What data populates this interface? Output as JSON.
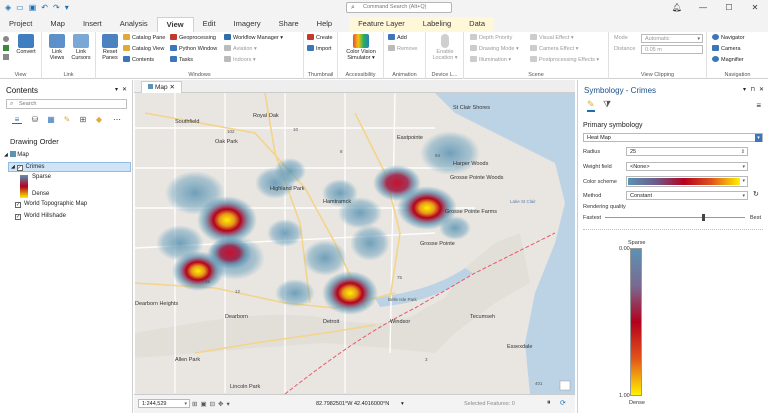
{
  "titlebar": {
    "search_placeholder": "Command Search (Alt+Q)",
    "minimize": "—",
    "maximize": "☐",
    "close": "✕"
  },
  "tabs": [
    "Project",
    "Map",
    "Insert",
    "Analysis",
    "View",
    "Edit",
    "Imagery",
    "Share",
    "Help",
    "Feature Layer",
    "Labeling",
    "Data"
  ],
  "ribbon": {
    "view_group": {
      "convert": "Convert",
      "label": "View"
    },
    "link_group": {
      "link_views": "Link Views",
      "link_cursors": "Link Cursors",
      "label": "Link"
    },
    "windows_group": {
      "reset_panes": "Reset Panes",
      "catalog_pane": "Catalog Pane",
      "catalog_view": "Catalog View",
      "contents": "Contents",
      "geoprocessing": "Geoprocessing",
      "python_window": "Python Window",
      "tasks": "Tasks",
      "workflow_manager": "Workflow Manager",
      "aviation": "Aviation",
      "indoors": "Indoors",
      "label": "Windows"
    },
    "thumbnail_group": {
      "create": "Create",
      "import": "Import",
      "label": "Thumbnail"
    },
    "accessibility_group": {
      "color_vision": "Color Vision Simulator",
      "label": "Accessibility"
    },
    "animation_group": {
      "add": "Add",
      "remove": "Remove",
      "label": "Animation"
    },
    "device_group": {
      "enable_location": "Enable Location",
      "label": "Device L..."
    },
    "scene_group": {
      "depth_priority": "Depth Priority",
      "drawing_mode": "Drawing Mode",
      "illumination": "Illumination",
      "visual_effect": "Visual Effect",
      "camera_effect": "Camera Effect",
      "postprocessing": "Postprocessing Effects",
      "label": "Scene"
    },
    "clipping_group": {
      "mode_label": "Mode",
      "mode_value": "Automatic",
      "distance_label": "Distance",
      "distance_value": "0.05 m",
      "label": "View Clipping"
    },
    "navigation_group": {
      "navigator": "Navigator",
      "camera": "Camera",
      "magnifier": "Magnifier",
      "label": "Navigation"
    }
  },
  "contents": {
    "title": "Contents",
    "search_placeholder": "Search",
    "drawing_order": "Drawing Order",
    "layers": {
      "map": "Map",
      "crimes": "Crimes",
      "sparse": "Sparse",
      "dense": "Dense",
      "topo": "World Topographic Map",
      "hillshade": "World Hillshade"
    }
  },
  "map": {
    "tab": "Map",
    "places": [
      "Royal Oak",
      "Southfield",
      "Oak Park",
      "Highland Park",
      "Hamtramck",
      "Dearborn",
      "Dearborn Heights",
      "Eastpointe",
      "St Clair Shores",
      "Grosse Pointe Woods",
      "Grosse Pointe Farms",
      "Grosse Pointe",
      "Harper Woods",
      "Detroit",
      "Windsor",
      "Tecumseh",
      "Lincoln Park",
      "Allen Park",
      "Belle Isle Park",
      "Essexdale"
    ],
    "water": "Lake St Clair",
    "roads": [
      "102",
      "10",
      "94",
      "75",
      "8",
      "39",
      "12",
      "3",
      "401"
    ]
  },
  "status": {
    "scale": "1:244,529",
    "coords": "82.7982501°W 42.4016000°N",
    "selected": "Selected Features: 0"
  },
  "symbology": {
    "title": "Symbology - Crimes",
    "primary": "Primary symbology",
    "renderer": "Heat Map",
    "radius_label": "Radius",
    "radius": "25",
    "weight_label": "Weight field",
    "weight": "<None>",
    "scheme_label": "Color scheme",
    "method_label": "Method",
    "method": "Constant",
    "quality_label": "Rendering quality",
    "fastest": "Fastest",
    "best": "Best",
    "quality": 0.7,
    "sparse": "Sparse",
    "dense": "Dense",
    "ramp_low": "0.00",
    "ramp_high": "1.00"
  },
  "colors": {
    "accent": "#1a6fb5",
    "heat_low": "#5b93b2",
    "heat_mid": "#b4001e",
    "heat_high": "#fff200"
  }
}
